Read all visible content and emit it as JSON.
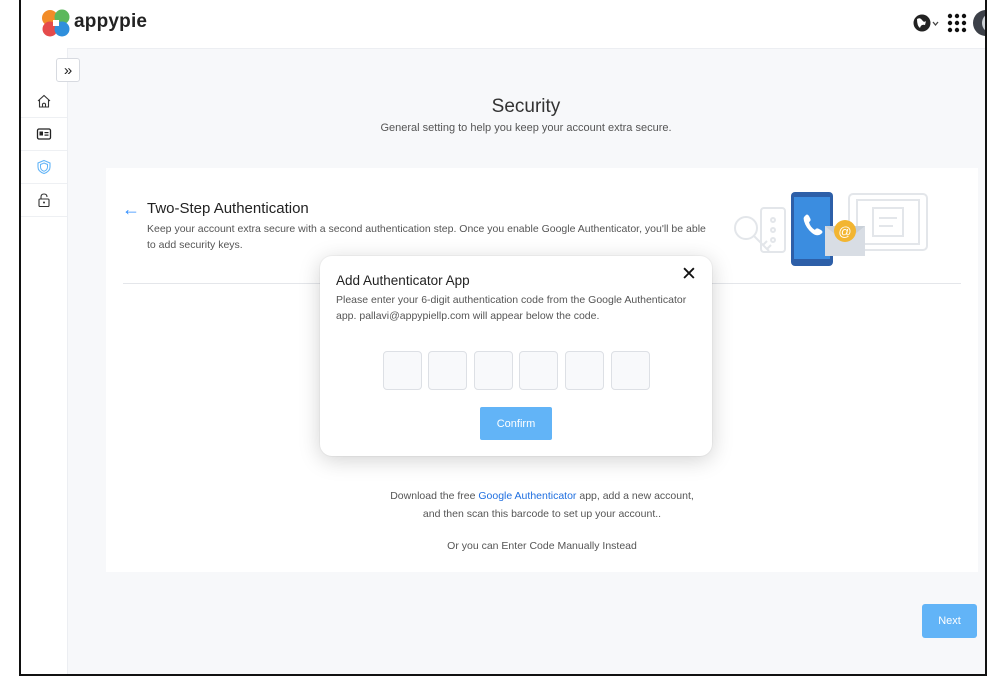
{
  "brand": {
    "name": "appypie"
  },
  "header": {
    "icons": [
      "globe-icon",
      "apps-grid-icon",
      "avatar"
    ]
  },
  "sidebar": {
    "toggle_label": "»",
    "items": [
      {
        "name": "home",
        "icon": "home-icon"
      },
      {
        "name": "profile",
        "icon": "id-card-icon"
      },
      {
        "name": "security",
        "icon": "shield-icon",
        "active": true
      },
      {
        "name": "privacy",
        "icon": "lock-icon"
      }
    ]
  },
  "page": {
    "title": "Security",
    "subtitle": "General setting to help you keep your account extra secure."
  },
  "two_step": {
    "back_icon": "←",
    "title": "Two-Step Authentication",
    "description": "Keep your account extra secure with a second authentication step. Once you enable Google Authenticator, you'll be able to add security keys."
  },
  "download": {
    "prefix": "Download the free ",
    "link": "Google Authenticator",
    "suffix": " app, add a new account,",
    "line2": "and then scan this barcode to set up your account..",
    "manual": "Or you can Enter Code Manually Instead"
  },
  "modal": {
    "title": "Add Authenticator App",
    "close_label": "✕",
    "description": "Please enter your 6-digit authentication code from the Google Authenticator app. pallavi@appypiellp.com will appear below the code.",
    "code_digits": [
      "",
      "",
      "",
      "",
      "",
      ""
    ],
    "confirm_label": "Confirm"
  },
  "footer": {
    "next_label": "Next"
  },
  "colors": {
    "accent": "#62b4f7",
    "link": "#1f6fe0",
    "arrow": "#2d8cff"
  }
}
